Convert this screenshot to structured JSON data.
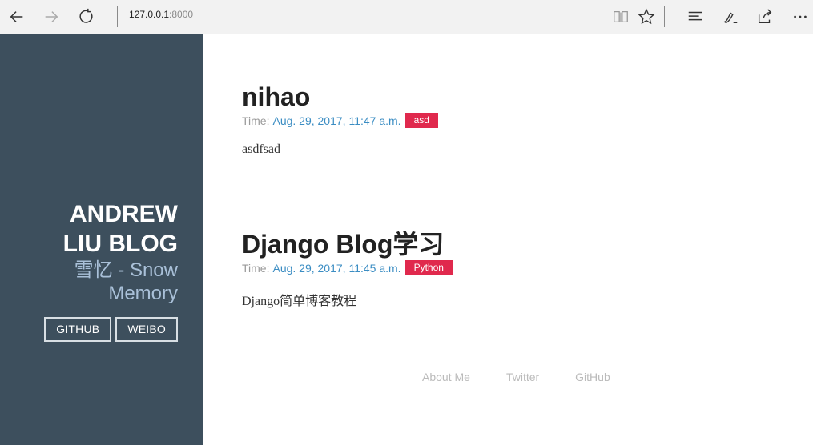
{
  "browser": {
    "url_host": "127.0.0.1",
    "url_port": ":8000",
    "icons": [
      "back-icon",
      "forward-icon",
      "refresh-icon",
      "reading-view-icon",
      "favorite-star-icon",
      "hub-icon",
      "web-note-icon",
      "share-icon",
      "more-icon"
    ]
  },
  "sidebar": {
    "title_line1": "ANDREW",
    "title_line2": "LIU BLOG",
    "subtitle_line1": "雪忆 - Snow",
    "subtitle_line2": "Memory",
    "buttons": [
      {
        "label": "GITHUB"
      },
      {
        "label": "WEIBO"
      }
    ]
  },
  "posts": [
    {
      "title": "nihao",
      "time_label": "Time:",
      "date": "Aug. 29, 2017, 11:47 a.m.",
      "tag": "asd",
      "excerpt": "asdfsad"
    },
    {
      "title": "Django Blog学习",
      "time_label": "Time:",
      "date": "Aug. 29, 2017, 11:45 a.m.",
      "tag": "Python",
      "excerpt": "Django简单博客教程"
    }
  ],
  "footer": {
    "links": [
      "About Me",
      "Twitter",
      "GitHub"
    ]
  },
  "colors": {
    "sidebar_bg": "#3d4f5d",
    "subtitle": "#a9c0d8",
    "date_link": "#3b8dc3",
    "tag_bg": "#e0294d"
  }
}
